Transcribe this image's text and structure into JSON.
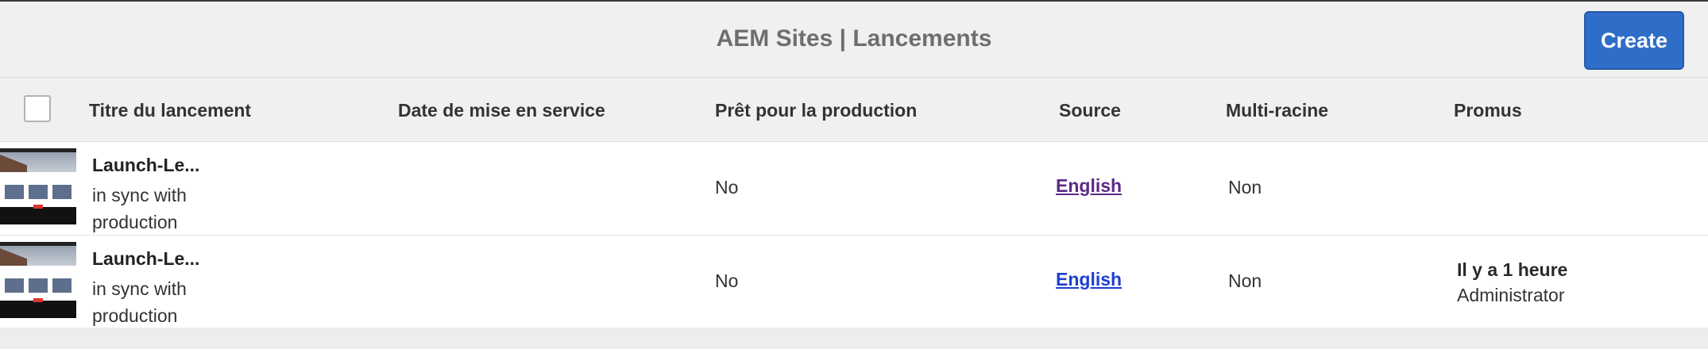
{
  "header": {
    "title": "AEM Sites | Lancements",
    "create_label": "Create"
  },
  "columns": {
    "title": "Titre du lancement",
    "live_date": "Date de mise en service",
    "production_ready": "Prêt pour la production",
    "source": "Source",
    "multi_root": "Multi-racine",
    "promoted": "Promus"
  },
  "rows": [
    {
      "title": "Launch-Le...",
      "status": "in sync with production",
      "production_ready": "No",
      "source": "English",
      "source_color": "#5b2a86",
      "multi_root": "Non",
      "promoted_time": "",
      "promoted_by": ""
    },
    {
      "title": "Launch-Le...",
      "status": "in sync with production",
      "production_ready": "No",
      "source": "English",
      "source_color": "#1f3fd1",
      "multi_root": "Non",
      "promoted_time": "Il y a 1 heure",
      "promoted_by": "Administrator"
    }
  ],
  "colors": {
    "accent": "#2f6ec8",
    "background": "#ededed"
  }
}
